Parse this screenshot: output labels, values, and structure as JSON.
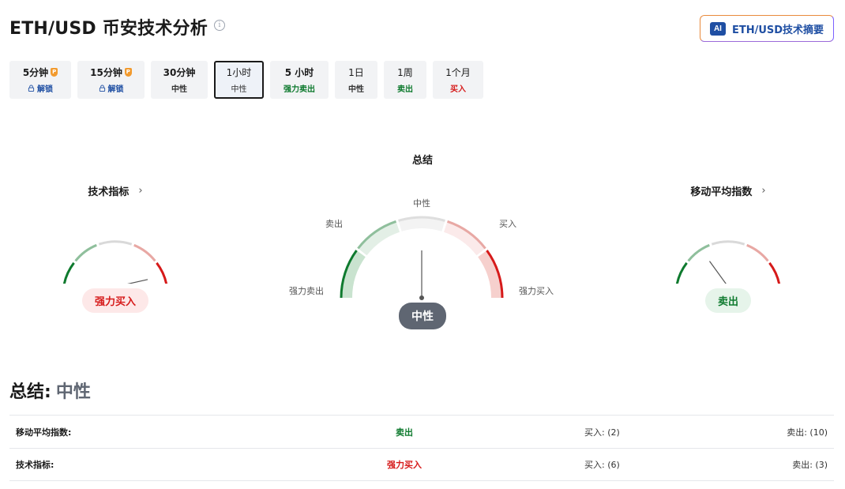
{
  "header": {
    "title": "ETH/USD 币安技术分析",
    "info_icon": "info-icon",
    "ai_badge": "AI",
    "ai_button_label": "ETH/USD技术摘要"
  },
  "tabs": [
    {
      "label": "5分钟",
      "sub": "解锁",
      "pro": true,
      "pro_glyph": "P",
      "status": "locked"
    },
    {
      "label": "15分钟",
      "sub": "解锁",
      "pro": true,
      "pro_glyph": "P",
      "status": "locked"
    },
    {
      "label": "30分钟",
      "sub": "中性",
      "status": "neutral"
    },
    {
      "label": "1小时",
      "sub": "中性",
      "status": "neutral",
      "active": true
    },
    {
      "label": "5 小时",
      "sub": "强力卖出",
      "status": "sell"
    },
    {
      "label": "1日",
      "sub": "中性",
      "status": "neutral"
    },
    {
      "label": "1周",
      "sub": "卖出",
      "status": "sell"
    },
    {
      "label": "1个月",
      "sub": "买入",
      "status": "buy"
    }
  ],
  "gauges": {
    "technical": {
      "title": "技术指标",
      "chevron": "›",
      "result": "强力买入",
      "level": 0.93
    },
    "summary": {
      "title": "总结",
      "result": "中性",
      "level": 0.5,
      "labels": {
        "strong_sell": "强力卖出",
        "sell": "卖出",
        "neutral": "中性",
        "buy": "买入",
        "strong_buy": "强力买入"
      }
    },
    "moving_averages": {
      "title": "移动平均指数",
      "chevron": "›",
      "result": "卖出",
      "level": 0.3
    }
  },
  "summary": {
    "heading_label": "总结:",
    "heading_value": "中性",
    "rows": [
      {
        "name": "移动平均指数:",
        "signal": "卖出",
        "buy": "买入: (2)",
        "sell": "卖出: (10)"
      },
      {
        "name": "技术指标:",
        "signal": "强力买入",
        "buy": "买入: (6)",
        "sell": "卖出: (3)"
      }
    ]
  },
  "colors": {
    "green": "#0e7a2e",
    "red": "#d61a1a",
    "neutral_pill": "#5f6672",
    "brand_blue": "#1f4fa3"
  }
}
